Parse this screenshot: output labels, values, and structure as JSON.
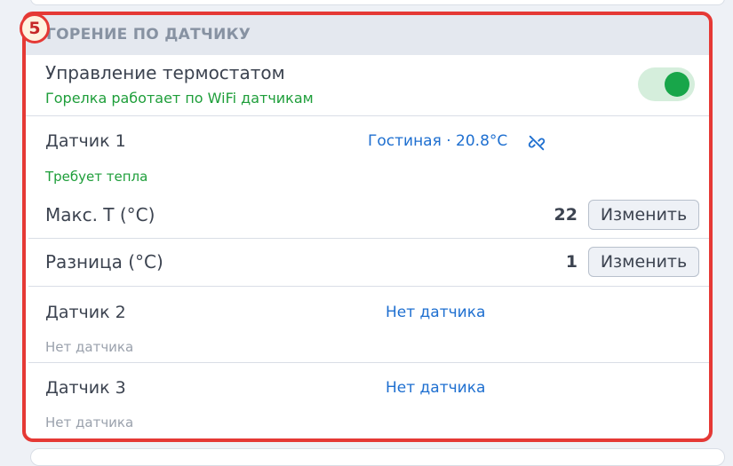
{
  "badge": {
    "number": "5"
  },
  "card": {
    "title": "ГОРЕНИЕ ПО ДАТЧИКУ"
  },
  "thermostat": {
    "label": "Управление термостатом",
    "status": "Горелка работает по WiFi датчикам",
    "toggle_on": true
  },
  "sensor1": {
    "label": "Датчик 1",
    "source": "Гостиная · 20.8°C",
    "status": "Требует тепла",
    "icon": "unlink-icon"
  },
  "max_temp": {
    "label": "Макс. Т (°C)",
    "value": "22",
    "button": "Изменить"
  },
  "diff": {
    "label": "Разница (°C)",
    "value": "1",
    "button": "Изменить"
  },
  "sensor2": {
    "label": "Датчик 2",
    "source": "Нет датчика",
    "status": "Нет датчика"
  },
  "sensor3": {
    "label": "Датчик 3",
    "source": "Нет датчика",
    "status": "Нет датчика"
  },
  "colors": {
    "accent_green": "#18a64a",
    "link_blue": "#1e6fd0",
    "highlight_red": "#e53935"
  }
}
